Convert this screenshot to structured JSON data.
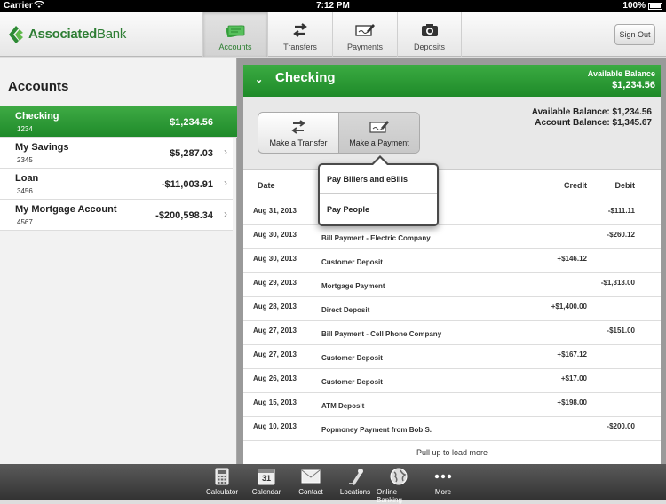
{
  "status_bar": {
    "carrier": "Carrier",
    "time": "7:12 PM",
    "battery": "100%"
  },
  "header": {
    "logo_text_bold": "Associated",
    "logo_text_rest": "Bank",
    "tabs": [
      {
        "label": "Accounts",
        "icon": "accounts-icon",
        "active": true
      },
      {
        "label": "Transfers",
        "icon": "transfers-icon"
      },
      {
        "label": "Payments",
        "icon": "payments-icon"
      },
      {
        "label": "Deposits",
        "icon": "deposits-icon"
      }
    ],
    "sign_out": "Sign Out"
  },
  "sidebar": {
    "title": "Accounts",
    "accounts": [
      {
        "name": "Checking",
        "number": "1234",
        "balance": "$1,234.56",
        "selected": true
      },
      {
        "name": "My Savings",
        "number": "2345",
        "balance": "$5,287.03"
      },
      {
        "name": "Loan",
        "number": "3456",
        "balance": "-$11,003.91"
      },
      {
        "name": "My Mortgage Account",
        "number": "4567",
        "balance": "-$200,598.34"
      }
    ]
  },
  "panel": {
    "title": "Checking",
    "available_label": "Available Balance",
    "available_value": "$1,234.56",
    "make_transfer": "Make a Transfer",
    "make_payment": "Make a Payment",
    "available_balance_text": "Available Balance: $1,234.56",
    "account_balance_text": "Account Balance: $1,345.67",
    "columns": {
      "date": "Date",
      "credit": "Credit",
      "debit": "Debit"
    },
    "transactions": [
      {
        "date": "Aug 31, 2013",
        "desc": "",
        "credit": "",
        "debit": "-$111.11"
      },
      {
        "date": "Aug 30, 2013",
        "desc": "Bill Payment - Electric Company",
        "credit": "",
        "debit": "-$260.12"
      },
      {
        "date": "Aug 30, 2013",
        "desc": "Customer Deposit",
        "credit": "+$146.12",
        "debit": ""
      },
      {
        "date": "Aug 29, 2013",
        "desc": "Mortgage Payment",
        "credit": "",
        "debit": "-$1,313.00"
      },
      {
        "date": "Aug 28, 2013",
        "desc": "Direct Deposit",
        "credit": "+$1,400.00",
        "debit": ""
      },
      {
        "date": "Aug 27, 2013",
        "desc": "Bill Payment - Cell Phone Company",
        "credit": "",
        "debit": "-$151.00"
      },
      {
        "date": "Aug 27, 2013",
        "desc": "Customer Deposit",
        "credit": "+$167.12",
        "debit": ""
      },
      {
        "date": "Aug 26, 2013",
        "desc": "Customer Deposit",
        "credit": "+$17.00",
        "debit": ""
      },
      {
        "date": "Aug 15, 2013",
        "desc": "ATM Deposit",
        "credit": "+$198.00",
        "debit": ""
      },
      {
        "date": "Aug 10, 2013",
        "desc": "Popmoney Payment from Bob S.",
        "credit": "",
        "debit": "-$200.00"
      }
    ],
    "load_more": "Pull up to load more"
  },
  "popover": {
    "items": [
      "Pay Billers and eBills",
      "Pay People"
    ]
  },
  "bottom_bar": {
    "items": [
      {
        "label": "Calculator",
        "icon": "calculator-icon"
      },
      {
        "label": "Calendar",
        "icon": "calendar-icon",
        "badge": "31"
      },
      {
        "label": "Contact",
        "icon": "envelope-icon"
      },
      {
        "label": "Locations",
        "icon": "location-pin-icon"
      },
      {
        "label": "Online Banking",
        "icon": "globe-icon"
      },
      {
        "label": "More",
        "icon": "more-icon"
      }
    ]
  },
  "colors": {
    "brand_green": "#1f8a2a",
    "accent_green": "#3eaa44"
  }
}
